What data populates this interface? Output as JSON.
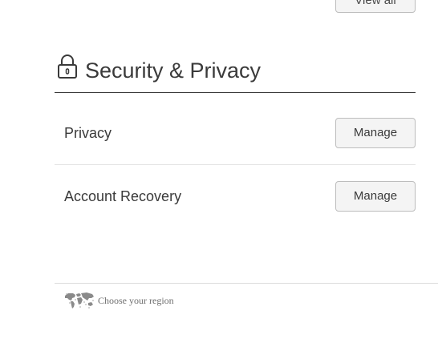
{
  "top": {
    "view_all_label": "View all"
  },
  "security": {
    "title": "Security & Privacy",
    "icon": "lock-icon",
    "rows": [
      {
        "label": "Privacy",
        "button_label": "Manage"
      },
      {
        "label": "Account Recovery",
        "button_label": "Manage"
      }
    ]
  },
  "footer": {
    "region_label": "Choose your region",
    "icon": "world-map-icon"
  },
  "colors": {
    "text": "#3a3a3a",
    "button_bg": "#f4f4f4",
    "button_border": "#bdbdbd",
    "divider": "#e3e3e3",
    "header_rule": "#3a3a3a",
    "footer_text": "#6e6e6e"
  }
}
